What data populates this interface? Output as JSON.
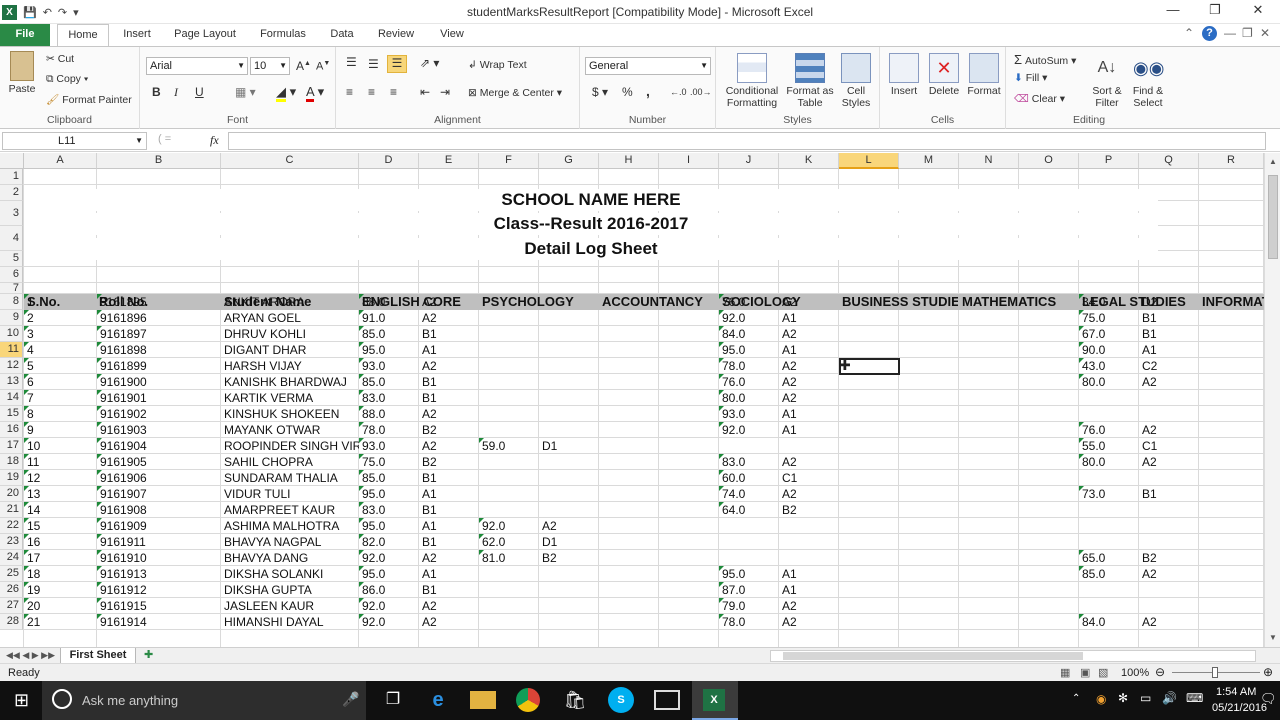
{
  "window": {
    "title": "studentMarksResultReport  [Compatibility Mode]  -  Microsoft Excel"
  },
  "tabs": [
    "File",
    "Home",
    "Insert",
    "Page Layout",
    "Formulas",
    "Data",
    "Review",
    "View"
  ],
  "clipboard": {
    "paste": "Paste",
    "cut": "Cut",
    "copy": "Copy",
    "format_painter": "Format Painter",
    "label": "Clipboard"
  },
  "font": {
    "name": "Arial",
    "size": "10",
    "bold": "B",
    "italic": "I",
    "underline": "U",
    "label": "Font"
  },
  "alignment": {
    "wrap": "Wrap Text",
    "merge": "Merge & Center",
    "label": "Alignment"
  },
  "number": {
    "format": "General",
    "currency": "$",
    "percent": "%",
    "comma": ",",
    "label": "Number"
  },
  "styles": {
    "conditional": "Conditional Formatting",
    "format_table": "Format as Table",
    "cell_styles": "Cell Styles",
    "label": "Styles"
  },
  "cells": {
    "insert": "Insert",
    "delete": "Delete",
    "format": "Format",
    "label": "Cells"
  },
  "editing": {
    "autosum": "AutoSum",
    "fill": "Fill",
    "clear": "Clear",
    "sort": "Sort & Filter",
    "find": "Find & Select",
    "label": "Editing"
  },
  "formula_bar": {
    "name_box": "L11",
    "fx": "fx",
    "value": ""
  },
  "columns": [
    "A",
    "B",
    "C",
    "D",
    "E",
    "F",
    "G",
    "H",
    "I",
    "J",
    "K",
    "L",
    "M",
    "N",
    "O",
    "P",
    "Q",
    "R"
  ],
  "selected_column": "L",
  "selected_row": "11",
  "sheet": {
    "title1": "SCHOOL NAME HERE",
    "title2": "Class--Result 2016-2017",
    "title3": "Detail Log Sheet",
    "header": {
      "sno": "S.No.",
      "roll": "Roll No.",
      "name": "Student Name",
      "english": "ENGLISH CORE",
      "psychology": "PSYCHOLOGY",
      "accountancy": "ACCOUNTANCY",
      "sociology": "SOCIOLOGY",
      "business": "BUSINESS STUDIES",
      "mathematics": "MATHEMATICS",
      "legal": "LEGAL STUDIES",
      "info": "INFORMATICS"
    },
    "rows": [
      {
        "row": "8",
        "sno": "1",
        "roll": "9161895",
        "name": "ANKIT ARORA",
        "eng": "88.0",
        "engg": "A2",
        "psy": "",
        "psyg": "",
        "soc": "76.0",
        "socg": "A2",
        "leg": "34.0",
        "legg": "D2"
      },
      {
        "row": "9",
        "sno": "2",
        "roll": "9161896",
        "name": "ARYAN GOEL",
        "eng": "91.0",
        "engg": "A2",
        "psy": "",
        "psyg": "",
        "soc": "92.0",
        "socg": "A1",
        "leg": "75.0",
        "legg": "B1"
      },
      {
        "row": "10",
        "sno": "3",
        "roll": "9161897",
        "name": "DHRUV KOHLI",
        "eng": "85.0",
        "engg": "B1",
        "psy": "",
        "psyg": "",
        "soc": "84.0",
        "socg": "A2",
        "leg": "67.0",
        "legg": "B1"
      },
      {
        "row": "11",
        "sno": "4",
        "roll": "9161898",
        "name": "DIGANT DHAR",
        "eng": "95.0",
        "engg": "A1",
        "psy": "",
        "psyg": "",
        "soc": "95.0",
        "socg": "A1",
        "leg": "90.0",
        "legg": "A1"
      },
      {
        "row": "12",
        "sno": "5",
        "roll": "9161899",
        "name": "HARSH VIJAY",
        "eng": "93.0",
        "engg": "A2",
        "psy": "",
        "psyg": "",
        "soc": "78.0",
        "socg": "A2",
        "leg": "43.0",
        "legg": "C2"
      },
      {
        "row": "13",
        "sno": "6",
        "roll": "9161900",
        "name": "KANISHK BHARDWAJ",
        "eng": "85.0",
        "engg": "B1",
        "psy": "",
        "psyg": "",
        "soc": "76.0",
        "socg": "A2",
        "leg": "80.0",
        "legg": "A2"
      },
      {
        "row": "14",
        "sno": "7",
        "roll": "9161901",
        "name": "KARTIK VERMA",
        "eng": "83.0",
        "engg": "B1",
        "psy": "",
        "psyg": "",
        "soc": "80.0",
        "socg": "A2",
        "leg": "",
        "legg": ""
      },
      {
        "row": "15",
        "sno": "8",
        "roll": "9161902",
        "name": "KINSHUK SHOKEEN",
        "eng": "88.0",
        "engg": "A2",
        "psy": "",
        "psyg": "",
        "soc": "93.0",
        "socg": "A1",
        "leg": "",
        "legg": ""
      },
      {
        "row": "16",
        "sno": "9",
        "roll": "9161903",
        "name": "MAYANK OTWAR",
        "eng": "78.0",
        "engg": "B2",
        "psy": "",
        "psyg": "",
        "soc": "92.0",
        "socg": "A1",
        "leg": "76.0",
        "legg": "A2"
      },
      {
        "row": "17",
        "sno": "10",
        "roll": "9161904",
        "name": "ROOPINDER SINGH VIR",
        "eng": "93.0",
        "engg": "A2",
        "psy": "59.0",
        "psyg": "D1",
        "soc": "",
        "socg": "",
        "leg": "55.0",
        "legg": "C1"
      },
      {
        "row": "18",
        "sno": "11",
        "roll": "9161905",
        "name": "SAHIL CHOPRA",
        "eng": "75.0",
        "engg": "B2",
        "psy": "",
        "psyg": "",
        "soc": "83.0",
        "socg": "A2",
        "leg": "80.0",
        "legg": "A2"
      },
      {
        "row": "19",
        "sno": "12",
        "roll": "9161906",
        "name": "SUNDARAM THALIA",
        "eng": "85.0",
        "engg": "B1",
        "psy": "",
        "psyg": "",
        "soc": "60.0",
        "socg": "C1",
        "leg": "",
        "legg": ""
      },
      {
        "row": "20",
        "sno": "13",
        "roll": "9161907",
        "name": "VIDUR TULI",
        "eng": "95.0",
        "engg": "A1",
        "psy": "",
        "psyg": "",
        "soc": "74.0",
        "socg": "A2",
        "leg": "73.0",
        "legg": "B1"
      },
      {
        "row": "21",
        "sno": "14",
        "roll": "9161908",
        "name": "AMARPREET KAUR",
        "eng": "83.0",
        "engg": "B1",
        "psy": "",
        "psyg": "",
        "soc": "64.0",
        "socg": "B2",
        "leg": "",
        "legg": ""
      },
      {
        "row": "22",
        "sno": "15",
        "roll": "9161909",
        "name": "ASHIMA MALHOTRA",
        "eng": "95.0",
        "engg": "A1",
        "psy": "92.0",
        "psyg": "A2",
        "soc": "",
        "socg": "",
        "leg": "",
        "legg": ""
      },
      {
        "row": "23",
        "sno": "16",
        "roll": "9161911",
        "name": "BHAVYA NAGPAL",
        "eng": "82.0",
        "engg": "B1",
        "psy": "62.0",
        "psyg": "D1",
        "soc": "",
        "socg": "",
        "leg": "",
        "legg": ""
      },
      {
        "row": "24",
        "sno": "17",
        "roll": "9161910",
        "name": "BHAVYA DANG",
        "eng": "92.0",
        "engg": "A2",
        "psy": "81.0",
        "psyg": "B2",
        "soc": "",
        "socg": "",
        "leg": "65.0",
        "legg": "B2"
      },
      {
        "row": "25",
        "sno": "18",
        "roll": "9161913",
        "name": "DIKSHA SOLANKI",
        "eng": "95.0",
        "engg": "A1",
        "psy": "",
        "psyg": "",
        "soc": "95.0",
        "socg": "A1",
        "leg": "85.0",
        "legg": "A2"
      },
      {
        "row": "26",
        "sno": "19",
        "roll": "9161912",
        "name": "DIKSHA GUPTA",
        "eng": "86.0",
        "engg": "B1",
        "psy": "",
        "psyg": "",
        "soc": "87.0",
        "socg": "A1",
        "leg": "",
        "legg": ""
      },
      {
        "row": "27",
        "sno": "20",
        "roll": "9161915",
        "name": "JASLEEN KAUR",
        "eng": "92.0",
        "engg": "A2",
        "psy": "",
        "psyg": "",
        "soc": "79.0",
        "socg": "A2",
        "leg": "",
        "legg": ""
      },
      {
        "row": "28",
        "sno": "21",
        "roll": "9161914",
        "name": "HIMANSHI DAYAL",
        "eng": "92.0",
        "engg": "A2",
        "psy": "",
        "psyg": "",
        "soc": "78.0",
        "socg": "A2",
        "leg": "84.0",
        "legg": "A2"
      }
    ]
  },
  "sheet_tab": "First Sheet",
  "status": {
    "ready": "Ready",
    "zoom": "100%"
  },
  "taskbar": {
    "search": "Ask me anything",
    "time": "1:54 AM",
    "date": "05/21/2016"
  },
  "colors": {
    "file_tab": "#2a8a46",
    "header_fill": "#bfbfbf",
    "selection": "#f9d67a",
    "error_triangle": "#1e8a3a"
  }
}
